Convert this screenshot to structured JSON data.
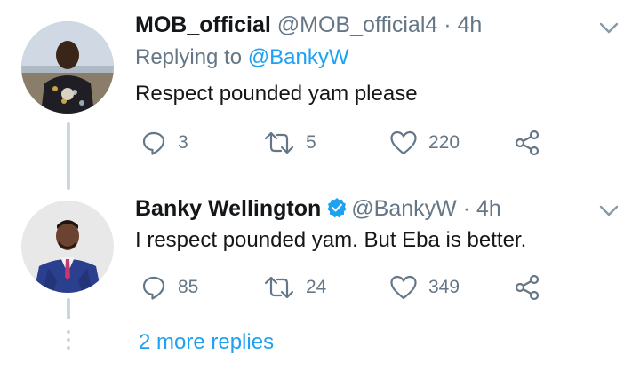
{
  "tweets": [
    {
      "name": "MOB_official",
      "handle": "@MOB_official4",
      "separator": "·",
      "time": "4h",
      "replying_prefix": "Replying to",
      "replying_to": "@BankyW",
      "text": "Respect pounded yam please",
      "verified": false,
      "replies": "3",
      "retweets": "5",
      "likes": "220",
      "icons": [
        "reply-icon",
        "retweet-icon",
        "like-icon",
        "share-icon",
        "chevron-down-icon"
      ]
    },
    {
      "name": "Banky Wellington",
      "handle": "@BankyW",
      "separator": "·",
      "time": "4h",
      "text": "I respect pounded yam. But Eba is better.",
      "verified": true,
      "replies": "85",
      "retweets": "24",
      "likes": "349",
      "icons": [
        "verified-badge-icon",
        "reply-icon",
        "retweet-icon",
        "like-icon",
        "share-icon",
        "chevron-down-icon"
      ]
    }
  ],
  "more_replies": "2 more replies",
  "colors": {
    "accent": "#1da1f2",
    "muted": "#657786",
    "text": "#14171a",
    "thread_line": "#ccd6dd"
  }
}
